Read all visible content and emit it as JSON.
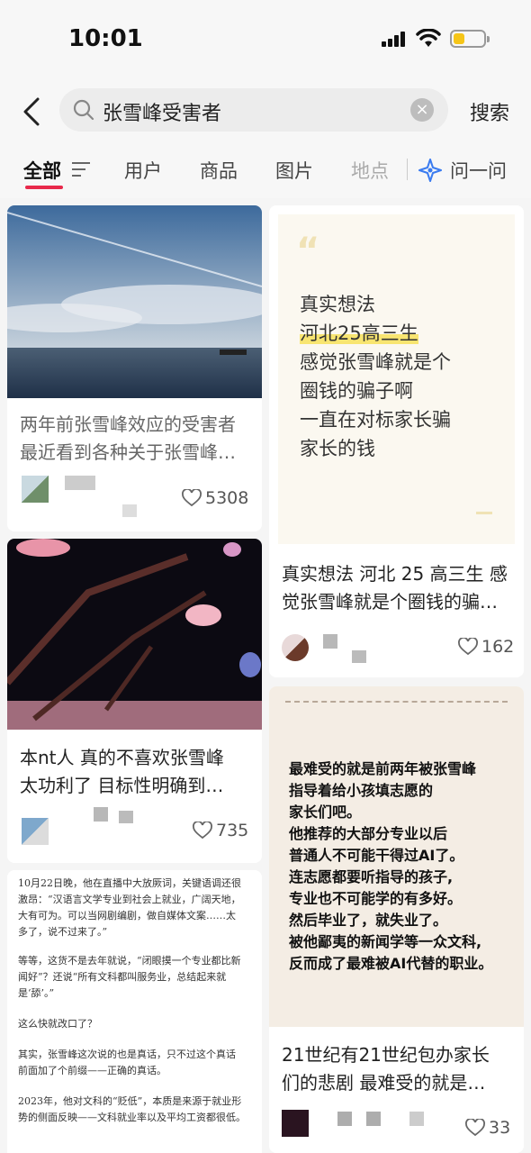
{
  "status": {
    "time": "10:01"
  },
  "search": {
    "query": "张雪峰受害者",
    "button": "搜索"
  },
  "tabs": [
    {
      "label": "全部"
    },
    {
      "label": "用户"
    },
    {
      "label": "商品"
    },
    {
      "label": "图片"
    },
    {
      "label": "地点"
    },
    {
      "label": "问一问"
    }
  ],
  "posts": [
    {
      "title_line1": "两年前张雪峰效应的受害者",
      "title_line2": "最近看到各种关于张雪峰…",
      "likes": "5308"
    },
    {
      "quote_lines": [
        "真实想法",
        "河北25高三生",
        "感觉张雪峰就是个",
        "圈钱的骗子啊",
        "一直在对标家长骗",
        "家长的钱"
      ],
      "title_line1": "真实想法 河北 25 高三生 感",
      "title_line2": "觉张雪峰就是个圈钱的骗…",
      "likes": "162"
    },
    {
      "title_line1": "本nt人 真的不喜欢张雪峰",
      "title_line2": "太功利了 目标性明确到…",
      "likes": "735"
    },
    {
      "image_lines": [
        "最难受的就是前两年被张雪峰",
        "指导着给小孩填志愿的",
        "家长们吧。",
        "他推荐的大部分专业以后",
        "普通人不可能干得过AI了。",
        "连志愿都要听指导的孩子,",
        "专业也不可能学的有多好。",
        "然后毕业了，就失业了。",
        "被他鄙夷的新闻学等一众文科,",
        "反而成了最难被AI代替的职业。"
      ],
      "title_line1": "21世纪有21世纪包办家长",
      "title_line2": "们的悲剧 最难受的就是…",
      "likes": "33"
    },
    {
      "doc_lines": [
        "10月22日晚，他在直播中大放厥词，关键语调还很",
        "激昂：“汉语言文学专业到社会上就业，广阔天地，",
        "大有可为。可以当网剧编剧，做自媒体文案……太",
        "多了，说不过来了。”",
        "",
        "等等，这货不是去年就说，“闭眼摸一个专业都比新",
        "闻好”？还说“所有文科都叫服务业，总结起来就",
        "是‘舔’。”",
        "",
        "这么快就改口了？",
        "",
        "其实，张雪峰这次说的也是真话，只不过这个真话",
        "前面加了个前缀——正确的真话。",
        "",
        "2023年，他对文科的“贬低”，本质是来源于就业形",
        "势的侧面反映——文科就业率以及平均工资都很低。"
      ]
    }
  ]
}
